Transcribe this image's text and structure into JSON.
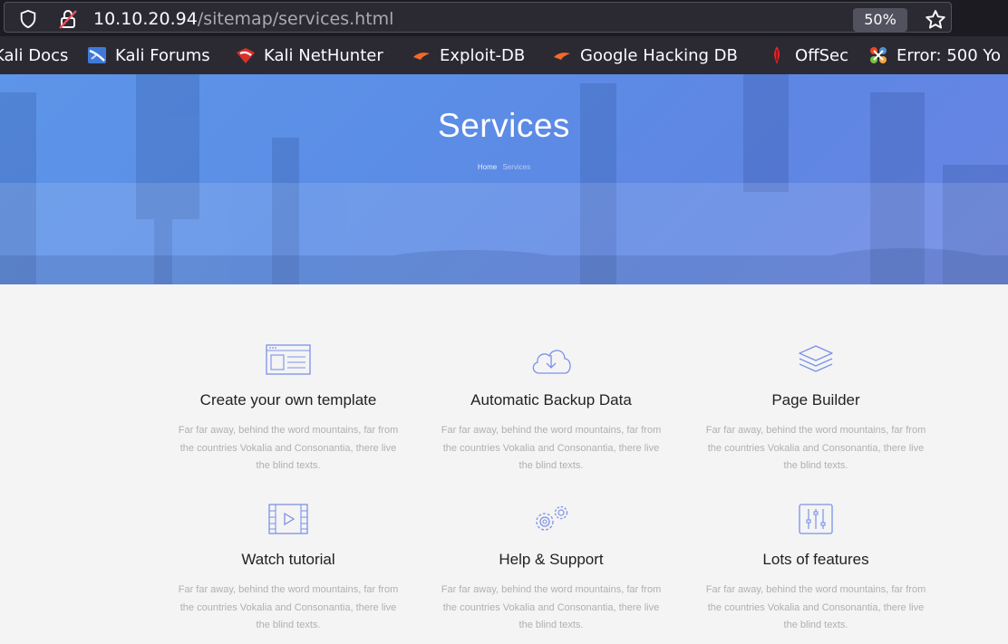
{
  "browser": {
    "url_host": "10.10.20.94",
    "url_path": "/sitemap/services.html",
    "zoom": "50%",
    "icons": [
      "shield-icon",
      "lock-warning-icon",
      "star-icon"
    ],
    "bookmarks": [
      {
        "label": "Kali Docs",
        "icon": "kali-docs-icon"
      },
      {
        "label": "Kali Forums",
        "icon": "kali-forums-icon"
      },
      {
        "label": "Kali NetHunter",
        "icon": "kali-nethunter-icon"
      },
      {
        "label": "Exploit-DB",
        "icon": "exploit-db-icon"
      },
      {
        "label": "Google Hacking DB",
        "icon": "ghdb-icon"
      },
      {
        "label": "OffSec",
        "icon": "offsec-icon"
      },
      {
        "label": "Error: 500 Yo",
        "icon": "joomla-icon"
      }
    ]
  },
  "hero": {
    "title": "Services",
    "breadcrumb": {
      "home": "Home",
      "current": "Services"
    }
  },
  "services": [
    {
      "title": "Create your own template",
      "icon": "template-icon",
      "text": "Far far away, behind the word mountains, far from the countries Vokalia and Consonantia, there live the blind texts."
    },
    {
      "title": "Automatic Backup Data",
      "icon": "cloud-download-icon",
      "text": "Far far away, behind the word mountains, far from the countries Vokalia and Consonantia, there live the blind texts."
    },
    {
      "title": "Page Builder",
      "icon": "layers-icon",
      "text": "Far far away, behind the word mountains, far from the countries Vokalia and Consonantia, there live the blind texts."
    },
    {
      "title": "Watch tutorial",
      "icon": "video-play-icon",
      "text": "Far far away, behind the word mountains, far from the countries Vokalia and Consonantia, there live the blind texts."
    },
    {
      "title": "Help & Support",
      "icon": "gears-icon",
      "text": "Far far away, behind the word mountains, far from the countries Vokalia and Consonantia, there live the blind texts."
    },
    {
      "title": "Lots of features",
      "icon": "sliders-icon",
      "text": "Far far away, behind the word mountains, far from the countries Vokalia and Consonantia, there live the blind texts."
    }
  ],
  "colors": {
    "accent_icon": "#7b92e8",
    "hero_blue": "#5d8fe6",
    "browser_dark": "#2b2a33"
  }
}
